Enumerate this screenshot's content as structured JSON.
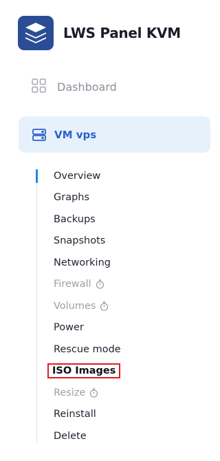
{
  "brand": {
    "name": "LWS Panel KVM",
    "logo_icon": "stack-layers-icon",
    "logo_color": "#2a4d95"
  },
  "nav": {
    "dashboard": {
      "label": "Dashboard",
      "icon": "grid-icon"
    },
    "vm": {
      "label": "VM vps",
      "icon": "server-icon",
      "bg": "#e6f1fc",
      "color": "#2b61c8"
    }
  },
  "submenu": {
    "active_index": 0,
    "highlight_index": 9,
    "items": [
      {
        "label": "Overview",
        "disabled": false
      },
      {
        "label": "Graphs",
        "disabled": false
      },
      {
        "label": "Backups",
        "disabled": false
      },
      {
        "label": "Snapshots",
        "disabled": false
      },
      {
        "label": "Networking",
        "disabled": false
      },
      {
        "label": "Firewall",
        "disabled": true,
        "icon": "stopwatch-icon"
      },
      {
        "label": "Volumes",
        "disabled": true,
        "icon": "stopwatch-icon"
      },
      {
        "label": "Power",
        "disabled": false
      },
      {
        "label": "Rescue mode",
        "disabled": false
      },
      {
        "label": "ISO Images",
        "disabled": false
      },
      {
        "label": "Resize",
        "disabled": true,
        "icon": "stopwatch-icon"
      },
      {
        "label": "Reinstall",
        "disabled": false
      },
      {
        "label": "Delete",
        "disabled": false
      }
    ]
  }
}
